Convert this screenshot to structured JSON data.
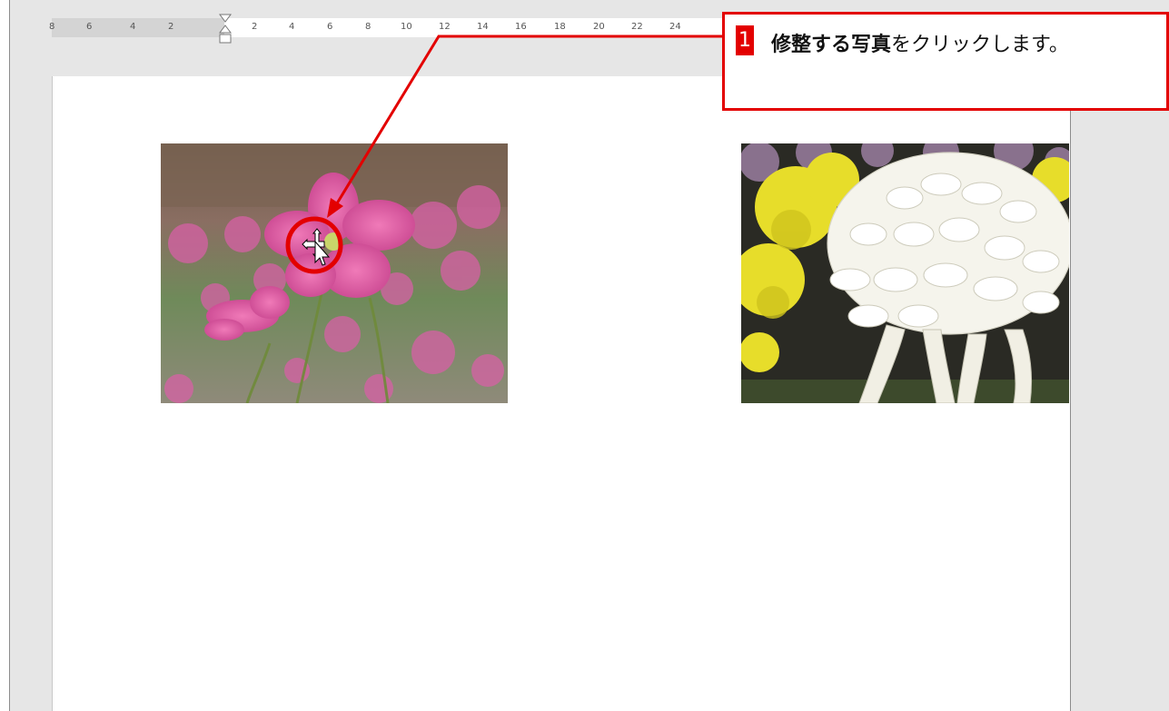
{
  "ruler": {
    "ticks": [
      "8",
      "6",
      "4",
      "2",
      "2",
      "4",
      "6",
      "8",
      "10",
      "12",
      "14",
      "16",
      "18",
      "20",
      "22",
      "24"
    ]
  },
  "callout": {
    "step_number": "1",
    "bold_text": "修整する写真",
    "rest_text": "をクリックします。"
  },
  "photos": [
    {
      "name": "pink flowers photo",
      "icon": "pink-flowers-image"
    },
    {
      "name": "white chrysanthemum photo",
      "icon": "chrysanthemum-image"
    }
  ],
  "colors": {
    "accent_red": "#e30000",
    "page_bg": "#ffffff",
    "workspace_bg": "#e6e6e6"
  },
  "cursor": {
    "icon": "move-cursor-icon"
  }
}
